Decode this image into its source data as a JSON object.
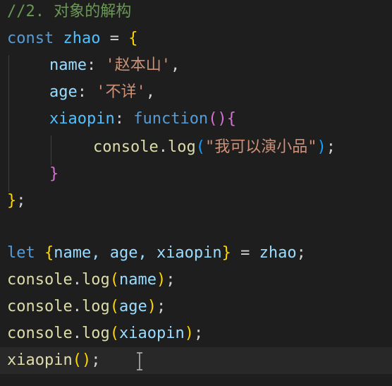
{
  "editor": {
    "line1": {
      "comment": "//2. 对象的解构"
    },
    "line2": {
      "kw": "const",
      "name": "zhao",
      "eq": "=",
      "brace": "{"
    },
    "line3": {
      "prop": "name",
      "colon": ":",
      "str": "'赵本山'",
      "comma": ","
    },
    "line4": {
      "prop": "age",
      "colon": ":",
      "str": "'不详'",
      "comma": ","
    },
    "line5": {
      "prop": "xiaopin",
      "colon": ":",
      "kw": "function",
      "parens": "()",
      "brace": "{"
    },
    "line6": {
      "obj": "console",
      "dot": ".",
      "fn": "log",
      "open": "(",
      "str": "\"我可以演小品\"",
      "close": ")",
      "semi": ";"
    },
    "line7": {
      "brace": "}"
    },
    "line8": {
      "brace": "}",
      "semi": ";"
    },
    "line10": {
      "kw": "let",
      "open": "{",
      "vars": "name, age, xiaopin",
      "close": "}",
      "eq": "=",
      "name": "zhao",
      "semi": ";"
    },
    "line11": {
      "obj": "console",
      "dot": ".",
      "fn": "log",
      "open": "(",
      "arg": "name",
      "close": ")",
      "semi": ";"
    },
    "line12": {
      "obj": "console",
      "dot": ".",
      "fn": "log",
      "open": "(",
      "arg": "age",
      "close": ")",
      "semi": ";"
    },
    "line13": {
      "obj": "console",
      "dot": ".",
      "fn": "log",
      "open": "(",
      "arg": "xiaopin",
      "close": ")",
      "semi": ";"
    },
    "line14": {
      "fn": "xiaopin",
      "parens": "()",
      "semi": ";"
    }
  },
  "icons": {
    "text-cursor": "i-beam-cursor-icon"
  },
  "colors": {
    "background": "#1e1e1e",
    "comment": "#6a9955",
    "keyword": "#569cd6",
    "string": "#ce9178",
    "function": "#dcdcaa",
    "property": "#9cdcfe"
  }
}
